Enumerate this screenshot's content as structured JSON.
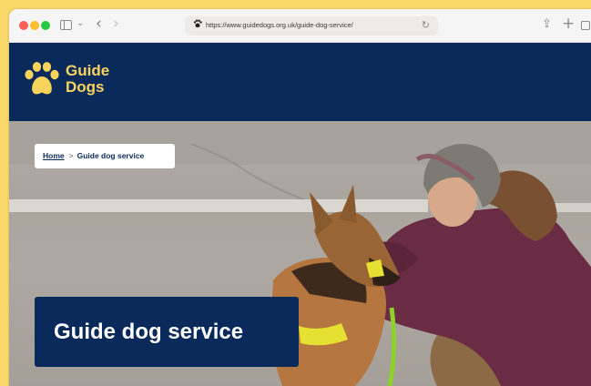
{
  "browser": {
    "url": "https://www.guidedogs.org.uk/guide-dog-service/",
    "icons": {
      "sidebar": "sidebar-icon",
      "back": "chevron-left-icon",
      "forward": "chevron-right-icon",
      "site": "paw-icon",
      "reload": "reload-icon",
      "share": "share-icon",
      "new_tab": "plus-icon",
      "tabs": "tabs-overview-icon"
    }
  },
  "header": {
    "logo_line1": "Guide",
    "logo_line2": "Dogs",
    "background_color": "#0b2a5c",
    "accent_color": "#f9d45c"
  },
  "breadcrumb": {
    "home_label": "Home",
    "separator": ">",
    "current_label": "Guide dog service"
  },
  "hero": {
    "title": "Guide dog service",
    "image_description_icon": "hero-photo"
  }
}
